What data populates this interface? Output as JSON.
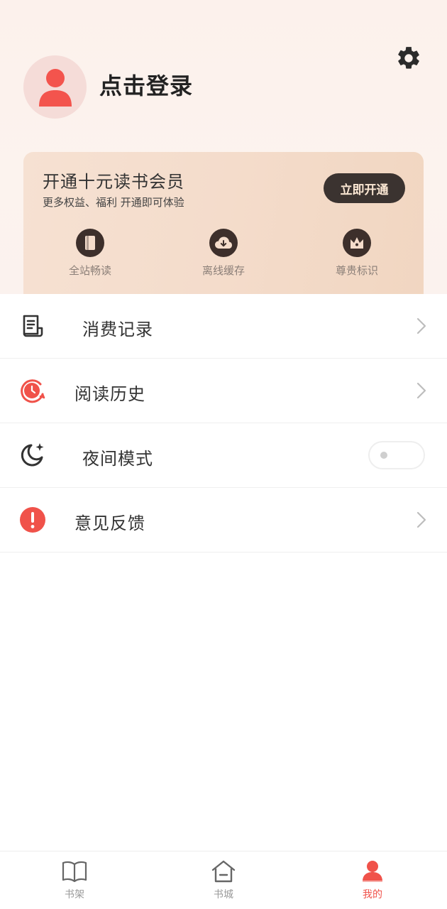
{
  "header": {
    "login_text": "点击登录"
  },
  "vip": {
    "title": "开通十元读书会员",
    "subtitle": "更多权益、福利 开通即可体验",
    "button_label": "立即开通",
    "perks": [
      {
        "label": "全站畅读",
        "icon": "book-icon"
      },
      {
        "label": "离线缓存",
        "icon": "cloud-download-icon"
      },
      {
        "label": "尊贵标识",
        "icon": "crown-icon"
      }
    ]
  },
  "menu": {
    "items": [
      {
        "label": "消费记录",
        "icon": "receipt-icon"
      },
      {
        "label": "阅读历史",
        "icon": "history-clock-icon"
      },
      {
        "label": "夜间模式",
        "icon": "moon-icon",
        "toggle_on": false
      },
      {
        "label": "意见反馈",
        "icon": "alert-icon"
      }
    ]
  },
  "tabbar": {
    "tabs": [
      {
        "label": "书架",
        "icon": "open-book-icon",
        "active": false
      },
      {
        "label": "书城",
        "icon": "home-icon",
        "active": false
      },
      {
        "label": "我的",
        "icon": "user-icon",
        "active": true
      }
    ]
  },
  "colors": {
    "accent": "#f0524a",
    "vip_button": "#3b3330",
    "perk_icon_bg": "#3d2f2b"
  }
}
